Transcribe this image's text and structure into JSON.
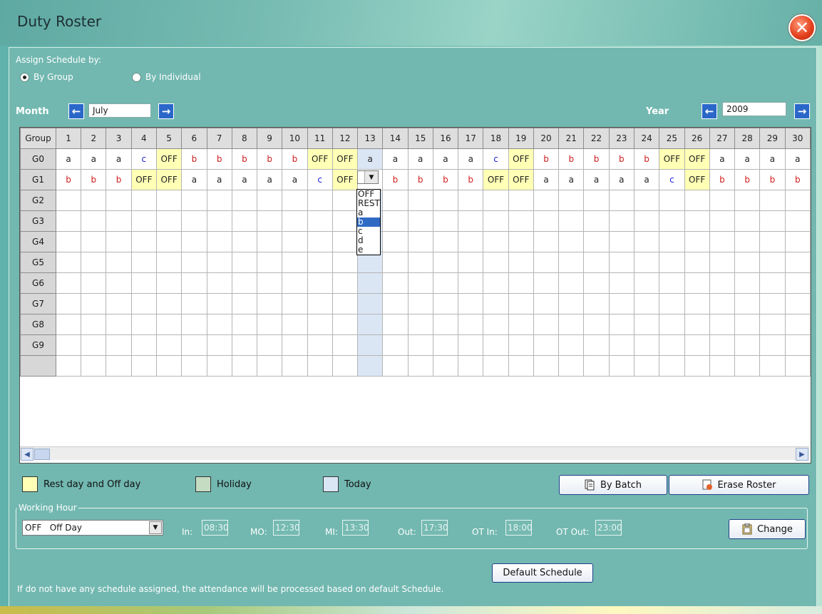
{
  "window": {
    "title": "Duty Roster",
    "close_icon": "close-icon"
  },
  "assign": {
    "label": "Assign Schedule by:",
    "options": [
      {
        "label": "By Group",
        "selected": true
      },
      {
        "label": "By Individual",
        "selected": false
      }
    ]
  },
  "month": {
    "label": "Month",
    "value": "July"
  },
  "year": {
    "label": "Year",
    "value": "2009"
  },
  "grid": {
    "header_label": "Group",
    "days": [
      "1",
      "2",
      "3",
      "4",
      "5",
      "6",
      "7",
      "8",
      "9",
      "10",
      "11",
      "12",
      "13",
      "14",
      "15",
      "16",
      "17",
      "18",
      "19",
      "20",
      "21",
      "22",
      "23",
      "24",
      "25",
      "26",
      "27",
      "28",
      "29",
      "30"
    ],
    "today_index": 12,
    "rows": [
      {
        "group": "G0",
        "cells": [
          "a",
          "a",
          "a",
          "c",
          "OFF",
          "b",
          "b",
          "b",
          "b",
          "b",
          "OFF",
          "OFF",
          "a",
          "a",
          "a",
          "a",
          "a",
          "c",
          "OFF",
          "b",
          "b",
          "b",
          "b",
          "b",
          "OFF",
          "OFF",
          "a",
          "a",
          "a",
          "a"
        ]
      },
      {
        "group": "G1",
        "cells": [
          "b",
          "b",
          "b",
          "OFF",
          "OFF",
          "a",
          "a",
          "a",
          "a",
          "a",
          "c",
          "OFF",
          "",
          "b",
          "b",
          "b",
          "b",
          "OFF",
          "OFF",
          "a",
          "a",
          "a",
          "a",
          "a",
          "c",
          "OFF",
          "b",
          "b",
          "b",
          "b"
        ]
      },
      {
        "group": "G2",
        "cells": []
      },
      {
        "group": "G3",
        "cells": []
      },
      {
        "group": "G4",
        "cells": []
      },
      {
        "group": "G5",
        "cells": []
      },
      {
        "group": "G6",
        "cells": []
      },
      {
        "group": "G7",
        "cells": []
      },
      {
        "group": "G8",
        "cells": []
      },
      {
        "group": "G9",
        "cells": []
      },
      {
        "group": "",
        "cells": []
      }
    ],
    "dropdown": {
      "options": [
        "OFF",
        "REST",
        "a",
        "b",
        "c",
        "d",
        "e"
      ],
      "selected": "b"
    }
  },
  "legend": {
    "rest_off": {
      "label": "Rest day and Off day",
      "color": "#ffffb5"
    },
    "holiday": {
      "label": "Holiday",
      "color": "#c5dcc2"
    },
    "today": {
      "label": "Today",
      "color": "#dbe6f5"
    }
  },
  "actions": {
    "by_batch": "By Batch",
    "erase_roster": "Erase Roster",
    "change": "Change",
    "default_schedule": "Default Schedule"
  },
  "working_hour": {
    "title": "Working Hour",
    "selected": "OFF   Off Day",
    "fields": [
      {
        "label": "In:",
        "value": "08:30"
      },
      {
        "label": "MO:",
        "value": "12:30"
      },
      {
        "label": "MI:",
        "value": "13:30"
      },
      {
        "label": "Out:",
        "value": "17:30"
      },
      {
        "label": "OT In:",
        "value": "18:00"
      },
      {
        "label": "OT Out:",
        "value": "23:00"
      }
    ]
  },
  "footer_note": "If do not have any schedule assigned, the attendance will be processed based on default Schedule."
}
